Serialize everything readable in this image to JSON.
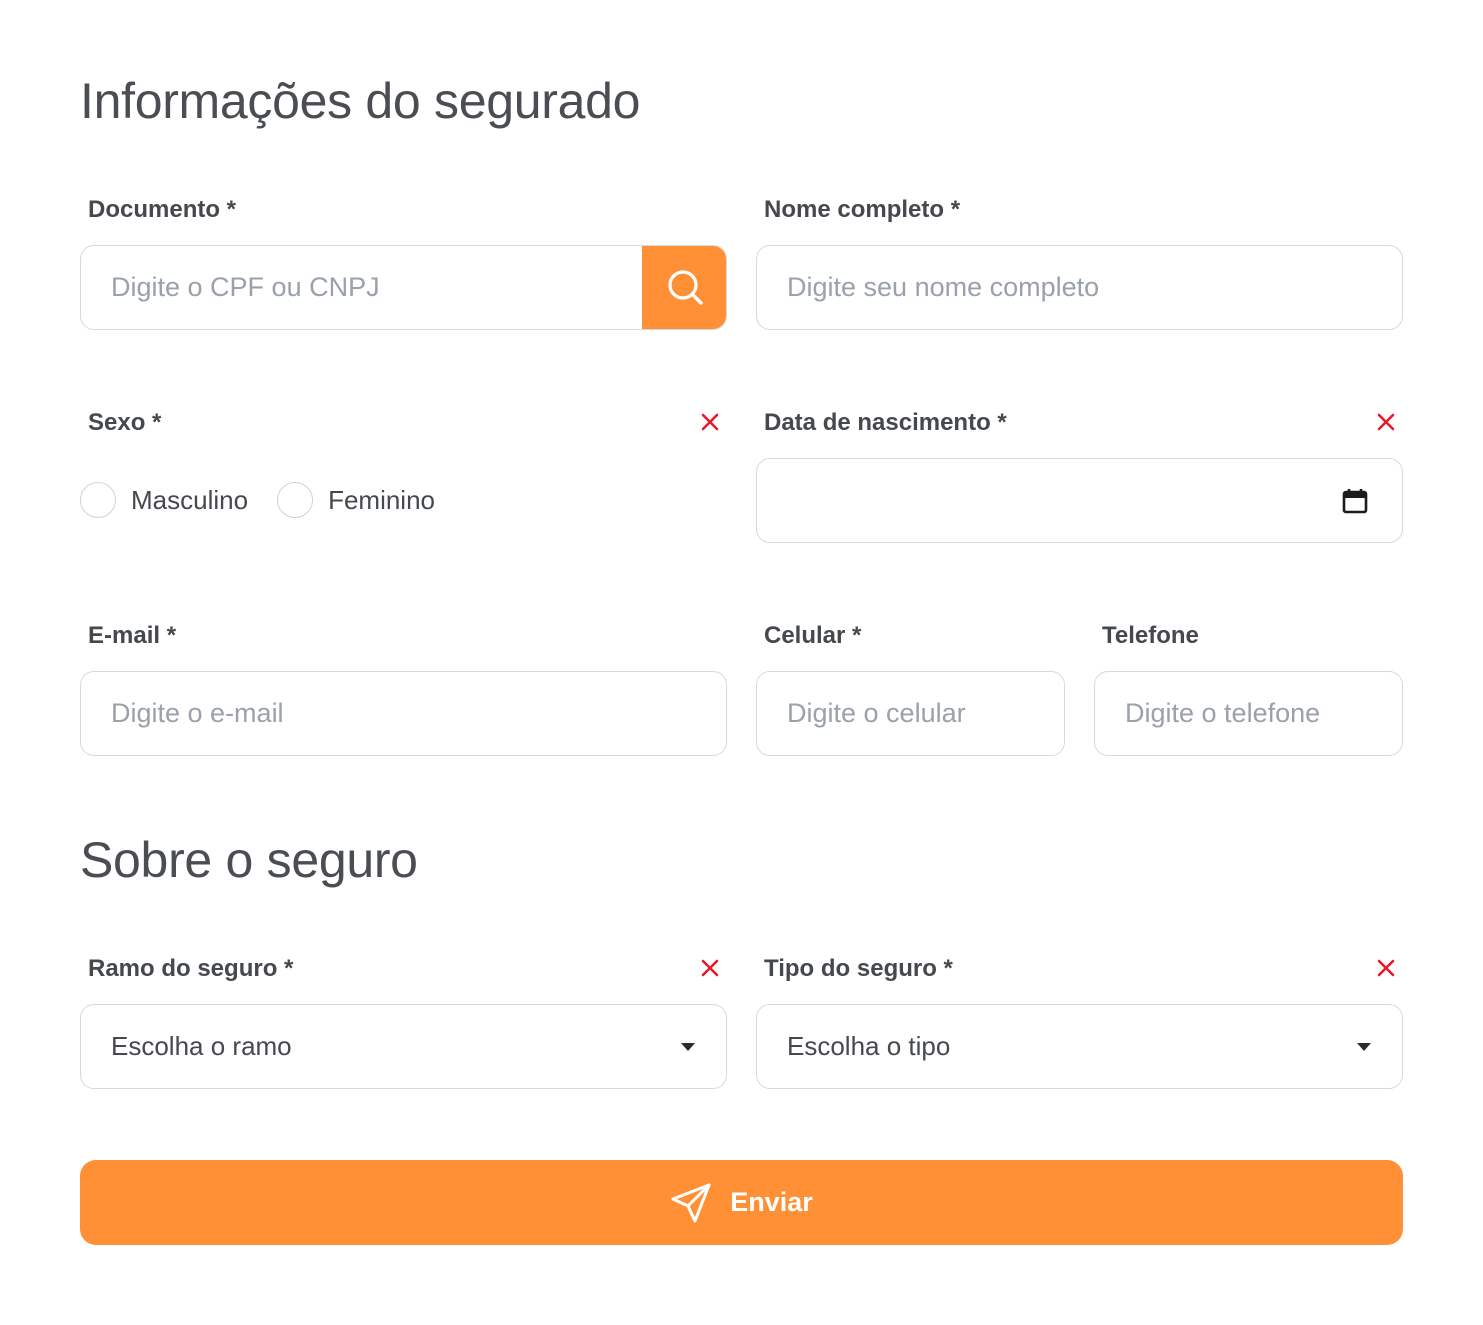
{
  "sections": {
    "insured_title": "Informações do segurado",
    "insurance_title": "Sobre o seguro"
  },
  "fields": {
    "document": {
      "label": "Documento *",
      "placeholder": "Digite o CPF ou CNPJ",
      "value": ""
    },
    "full_name": {
      "label": "Nome completo *",
      "placeholder": "Digite seu nome completo",
      "value": ""
    },
    "sex": {
      "label": "Sexo *",
      "options": [
        "Masculino",
        "Feminino"
      ],
      "selected": null
    },
    "birth_date": {
      "label": "Data de nascimento *",
      "value": ""
    },
    "email": {
      "label": "E-mail *",
      "placeholder": "Digite o e-mail",
      "value": ""
    },
    "mobile": {
      "label": "Celular *",
      "placeholder": "Digite o celular",
      "value": ""
    },
    "phone": {
      "label": "Telefone",
      "placeholder": "Digite o telefone",
      "value": ""
    },
    "insurance_branch": {
      "label": "Ramo do seguro *",
      "selected": "Escolha o ramo"
    },
    "insurance_type": {
      "label": "Tipo do seguro *",
      "selected": "Escolha o tipo"
    }
  },
  "submit": {
    "label": "Enviar"
  },
  "icons": {
    "search": "search-icon",
    "calendar": "calendar-icon",
    "error": "close-icon",
    "dropdown": "caret-down-icon",
    "send": "send-icon"
  },
  "colors": {
    "accent": "#ff9035",
    "error": "#e8192c",
    "border": "#d6d9de",
    "placeholder": "#9aa1aa",
    "text": "#45484d"
  }
}
